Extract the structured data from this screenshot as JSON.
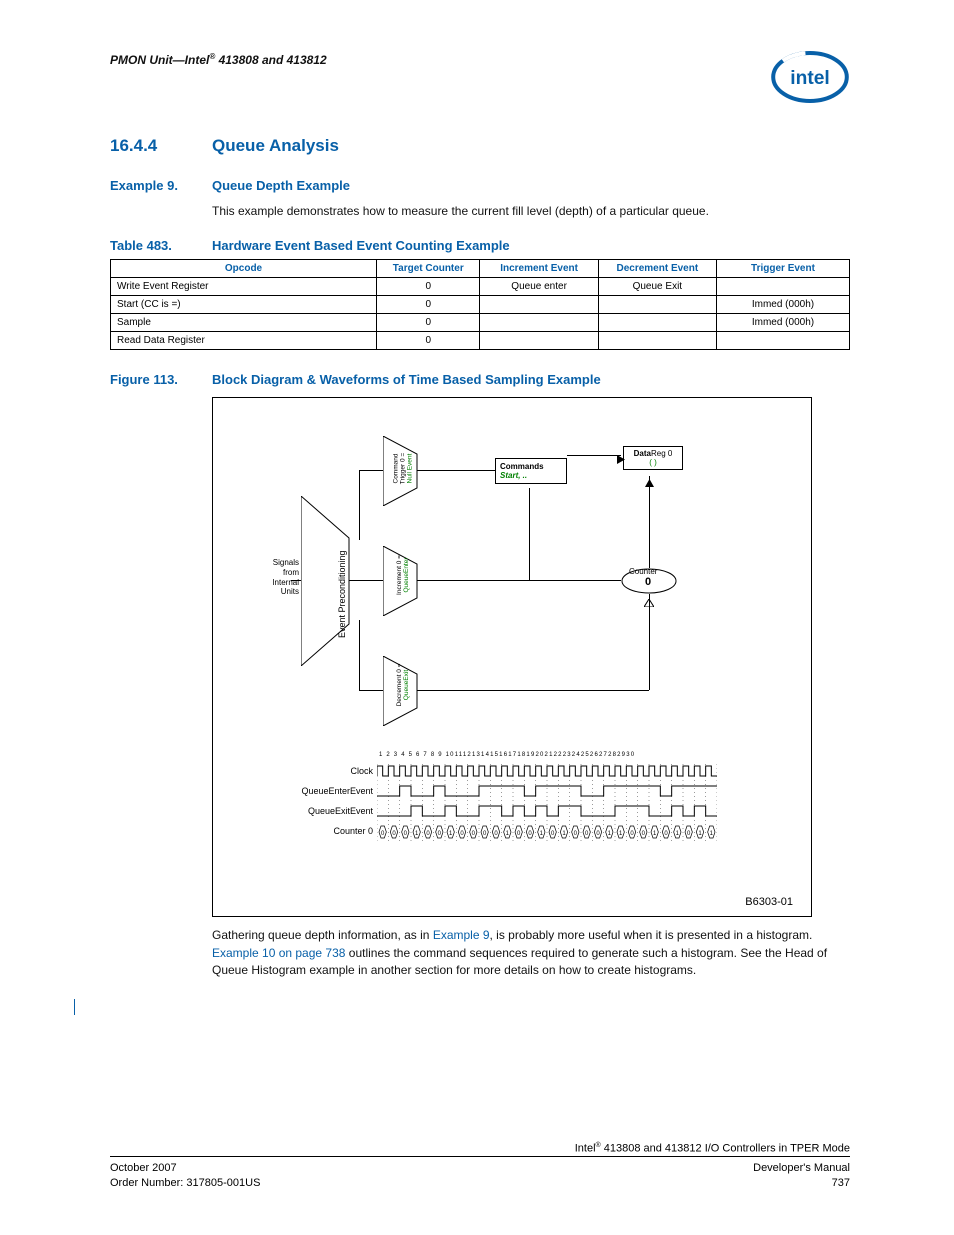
{
  "header": {
    "left_html": "PMON Unit—Intel",
    "left_sup": "®",
    "left_tail": " 413808 and 413812"
  },
  "section": {
    "num": "16.4.4",
    "title": "Queue Analysis"
  },
  "example": {
    "num": "Example 9.",
    "title": "Queue Depth Example"
  },
  "para1": "This example demonstrates how to measure the current fill level (depth) of a particular queue.",
  "table_caption": {
    "num": "Table 483.",
    "title": "Hardware Event Based Event Counting Example"
  },
  "table": {
    "headers": [
      "Opcode",
      "Target Counter",
      "Increment Event",
      "Decrement Event",
      "Trigger Event"
    ],
    "rows": [
      [
        "Write Event Register",
        "0",
        "Queue enter",
        "Queue Exit",
        ""
      ],
      [
        "Start (CC is =)",
        "0",
        "",
        "",
        "Immed (000h)"
      ],
      [
        "Sample",
        "0",
        "",
        "",
        "Immed (000h)"
      ],
      [
        "Read Data Register",
        "0",
        "",
        "",
        ""
      ]
    ]
  },
  "figure_caption": {
    "num": "Figure 113.",
    "title": "Block Diagram & Waveforms of Time Based Sampling Example"
  },
  "diagram": {
    "signals_label": "Signals from Internal Units",
    "precond_label": "Event Preconditioning",
    "mux_top": {
      "line1": "Command",
      "line2": "Trigger 0 =",
      "line3": "Null Event"
    },
    "mux_mid": {
      "line1": "Increment 0 =",
      "line2": "QueueEnter"
    },
    "mux_bot": {
      "line1": "Decrement 0 =",
      "line2": "QueueExit"
    },
    "commands_box": {
      "line1": "Commands",
      "line2": "Start, .."
    },
    "data_box": {
      "label": "Data",
      "reg": "Reg 0",
      "paren": "( )"
    },
    "counter": {
      "label": "Counter",
      "value": "0"
    }
  },
  "waveform": {
    "ticks": "1  2  3  4  5  6  7  8  9 101112131415161718192021222324252627282930",
    "rows": [
      "Clock",
      "QueueEnterEvent",
      "QueueExitEvent",
      "Counter 0"
    ],
    "counter_vals": [
      "0",
      "0",
      "0",
      "1",
      "0",
      "0",
      "1",
      "0",
      "0",
      "0",
      "0",
      "1",
      "0",
      "0",
      "1",
      "0",
      "1",
      "0",
      "0",
      "0",
      "1",
      "1",
      "0",
      "0",
      "1",
      "0",
      "1",
      "0",
      "1",
      "1"
    ]
  },
  "figure_id": "B6303-01",
  "para2_pre": "Gathering queue depth information, as in ",
  "para2_link1": "Example 9",
  "para2_mid": ", is probably more useful when it is presented in a histogram. ",
  "para2_link2": "Example 10 on page 738",
  "para2_post": " outlines the command sequences required to generate such a histogram. See the Head of Queue Histogram example in another section for more details on how to create histograms.",
  "footer": {
    "right_top_pre": "Intel",
    "right_top_sup": "®",
    "right_top_post": " 413808 and 413812 I/O Controllers in TPER Mode",
    "left1": "October 2007",
    "right1": "Developer's Manual",
    "left2": "Order Number: 317805-001US",
    "right2": "737"
  }
}
